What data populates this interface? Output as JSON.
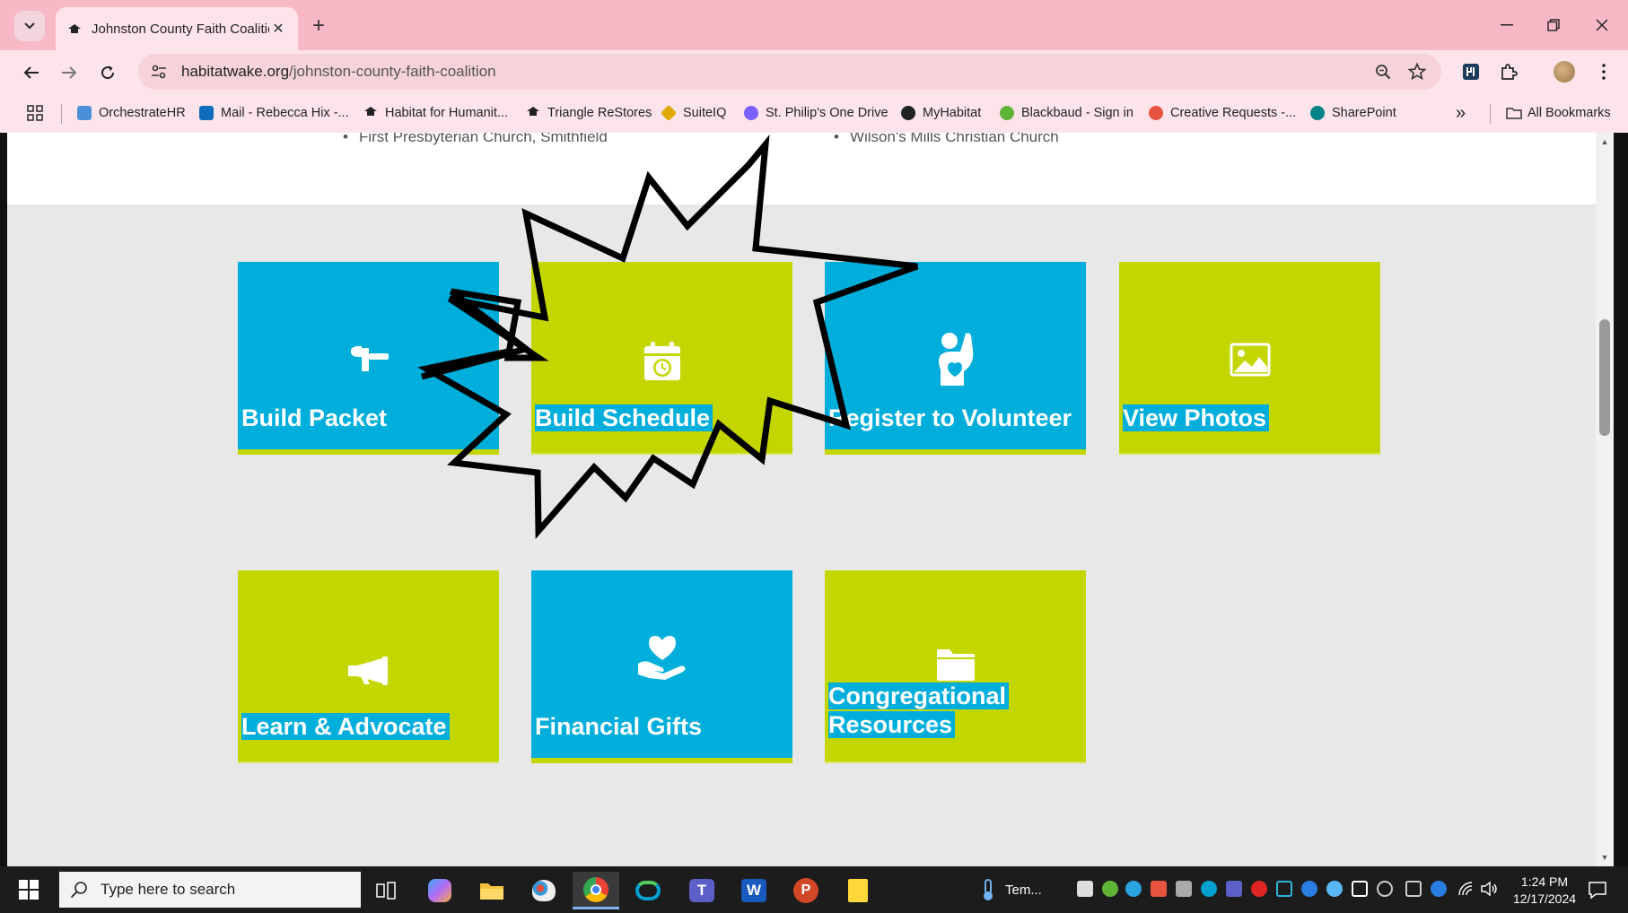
{
  "browser": {
    "tab_title": "Johnston County Faith Coalition",
    "new_tab_symbol": "+",
    "url_domain": "habitatwake.org",
    "url_path": "/johnston-county-faith-coalition",
    "bookmarks": [
      {
        "label": "OrchestrateHR",
        "color": "#4a90d9"
      },
      {
        "label": "Mail - Rebecca Hix -...",
        "color": "#0f6cbd"
      },
      {
        "label": "Habitat for Humanit...",
        "color": "#333333"
      },
      {
        "label": "Triangle ReStores",
        "color": "#333333"
      },
      {
        "label": "SuiteIQ",
        "color": "#e0a800"
      },
      {
        "label": "St. Philip's One Drive",
        "color": "#7b61ff"
      },
      {
        "label": "MyHabitat",
        "color": "#222222"
      },
      {
        "label": "Blackbaud - Sign in",
        "color": "#5fb336"
      },
      {
        "label": "Creative Requests -...",
        "color": "#e8533f"
      },
      {
        "label": "SharePoint",
        "color": "#038387"
      }
    ],
    "overflow_symbol": "»",
    "all_bookmarks": "All Bookmarks"
  },
  "page": {
    "top_list": {
      "left_item": "First Presbyterian Church, Smithfield",
      "right_item": "Wilson's Mills Christian Church"
    },
    "tiles": [
      {
        "label": "Build Packet",
        "color": "blue",
        "icon": "hammer-icon"
      },
      {
        "label": "Build Schedule",
        "color": "green",
        "icon": "calendar-clock-icon"
      },
      {
        "label": "Register to Volunteer",
        "color": "blue",
        "icon": "volunteer-hand-icon"
      },
      {
        "label": "View Photos",
        "color": "green",
        "icon": "image-icon"
      },
      {
        "label": "Learn & Advocate",
        "color": "green",
        "icon": "megaphone-icon"
      },
      {
        "label": "Financial Gifts",
        "color": "blue",
        "icon": "heart-hand-icon"
      },
      {
        "label_line1": "Congregational",
        "label_line2": "Resources",
        "color": "green",
        "icon": "folder-icon"
      }
    ],
    "colors": {
      "blue": "#00aedb",
      "green": "#c4d600",
      "gray_bg": "#e8e8e8"
    }
  },
  "taskbar": {
    "search_placeholder": "Type here to search",
    "weather_label": "Tem...",
    "time": "1:24 PM",
    "date": "12/17/2024"
  }
}
